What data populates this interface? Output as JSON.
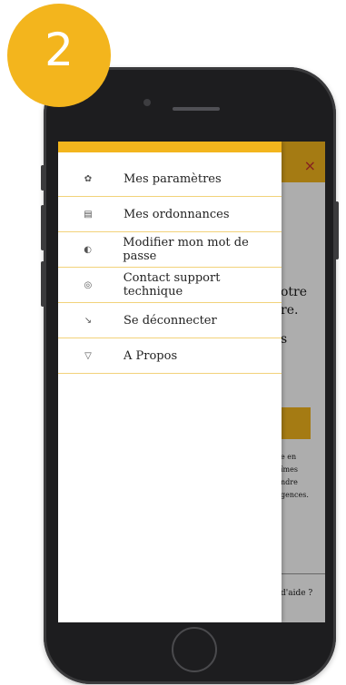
{
  "badge": {
    "step_number": "2"
  },
  "background_page": {
    "close_symbol": "×",
    "text_fragments": {
      "line1": "otre",
      "line2": "re.",
      "line3": "s",
      "line4": "e en",
      "line5": "îmes",
      "line6": "ndre",
      "line7": "gences.",
      "help": "d'aide ?"
    }
  },
  "menu": {
    "items": [
      {
        "label": "Mes paramètres",
        "icon": "gear-icon",
        "glyph": "✿"
      },
      {
        "label": "Mes ordonnances",
        "icon": "document-icon",
        "glyph": "▤"
      },
      {
        "label": "Modifier mon mot de passe",
        "icon": "shield-icon",
        "glyph": "◐"
      },
      {
        "label": "Contact support technique",
        "icon": "support-icon",
        "glyph": "◎"
      },
      {
        "label": "Se déconnecter",
        "icon": "logout-icon",
        "glyph": "↘"
      },
      {
        "label": "A Propos",
        "icon": "info-icon",
        "glyph": "▽"
      }
    ]
  },
  "colors": {
    "accent": "#f3b51d",
    "close": "#c53030"
  }
}
